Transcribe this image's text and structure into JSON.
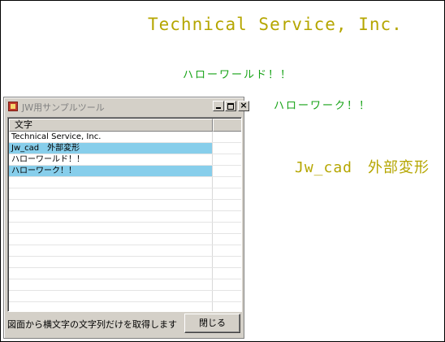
{
  "cad_drawing": {
    "texts": [
      "Technical Service, Inc.",
      "ハローワールド！！",
      "ハローワーク！！",
      "Jw_cad　外部変形"
    ],
    "colors": {
      "olive_text": "#b5a600",
      "green_text": "#17a317"
    }
  },
  "dialog": {
    "title": "JW用サンプルツール",
    "icon": "app-icon",
    "caption_buttons": {
      "minimize": "minimize-icon",
      "maximize": "maximize-icon",
      "close": "×"
    },
    "list": {
      "columns": [
        "文字",
        ""
      ],
      "rows": [
        {
          "text": "Technical Service, Inc.",
          "selected": false
        },
        {
          "text": "Jw_cad　外部変形",
          "selected": true
        },
        {
          "text": "ハローワールド！！",
          "selected": false
        },
        {
          "text": "ハローワーク！！",
          "selected": true
        }
      ],
      "selection_color": "#87ceeb"
    },
    "status": "図面から横文字の文字列だけを取得します",
    "close_button": "閉じる"
  }
}
